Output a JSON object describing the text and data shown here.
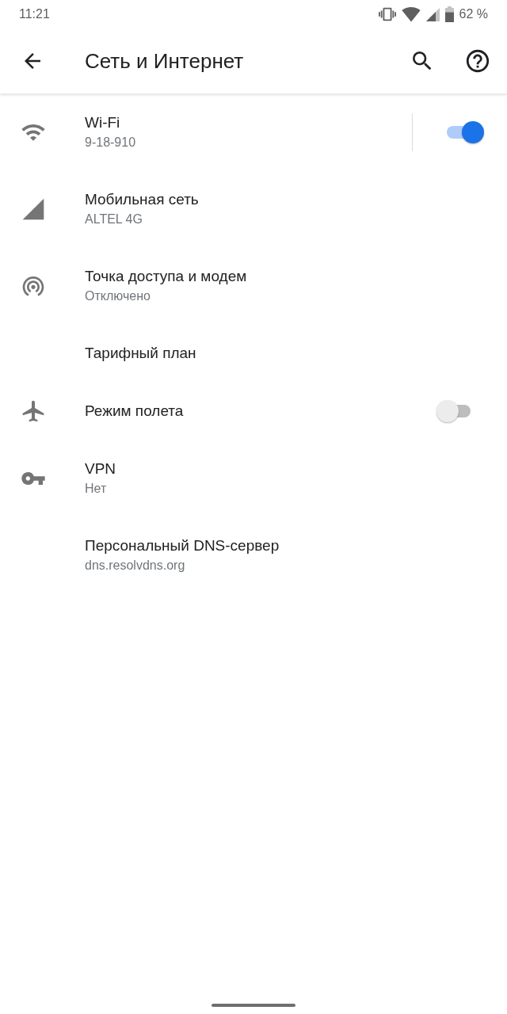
{
  "status_bar": {
    "time": "11:21",
    "battery": "62 %"
  },
  "app_bar": {
    "title": "Сеть и Интернет"
  },
  "items": [
    {
      "kind": "wifi",
      "title": "Wi-Fi",
      "subtitle": "9-18-910",
      "on": true
    },
    {
      "kind": "mobile",
      "title": "Мобильная сеть",
      "subtitle": "ALTEL 4G"
    },
    {
      "kind": "hotspot",
      "title": "Точка доступа и модем",
      "subtitle": "Отключено"
    },
    {
      "kind": "data-plan",
      "title": "Тарифный план"
    },
    {
      "kind": "airplane",
      "title": "Режим полета",
      "on": false
    },
    {
      "kind": "vpn",
      "title": "VPN",
      "subtitle": "Нет"
    },
    {
      "kind": "dns",
      "title": "Персональный DNS-сервер",
      "subtitle": "dns.resolvdns.org"
    }
  ]
}
